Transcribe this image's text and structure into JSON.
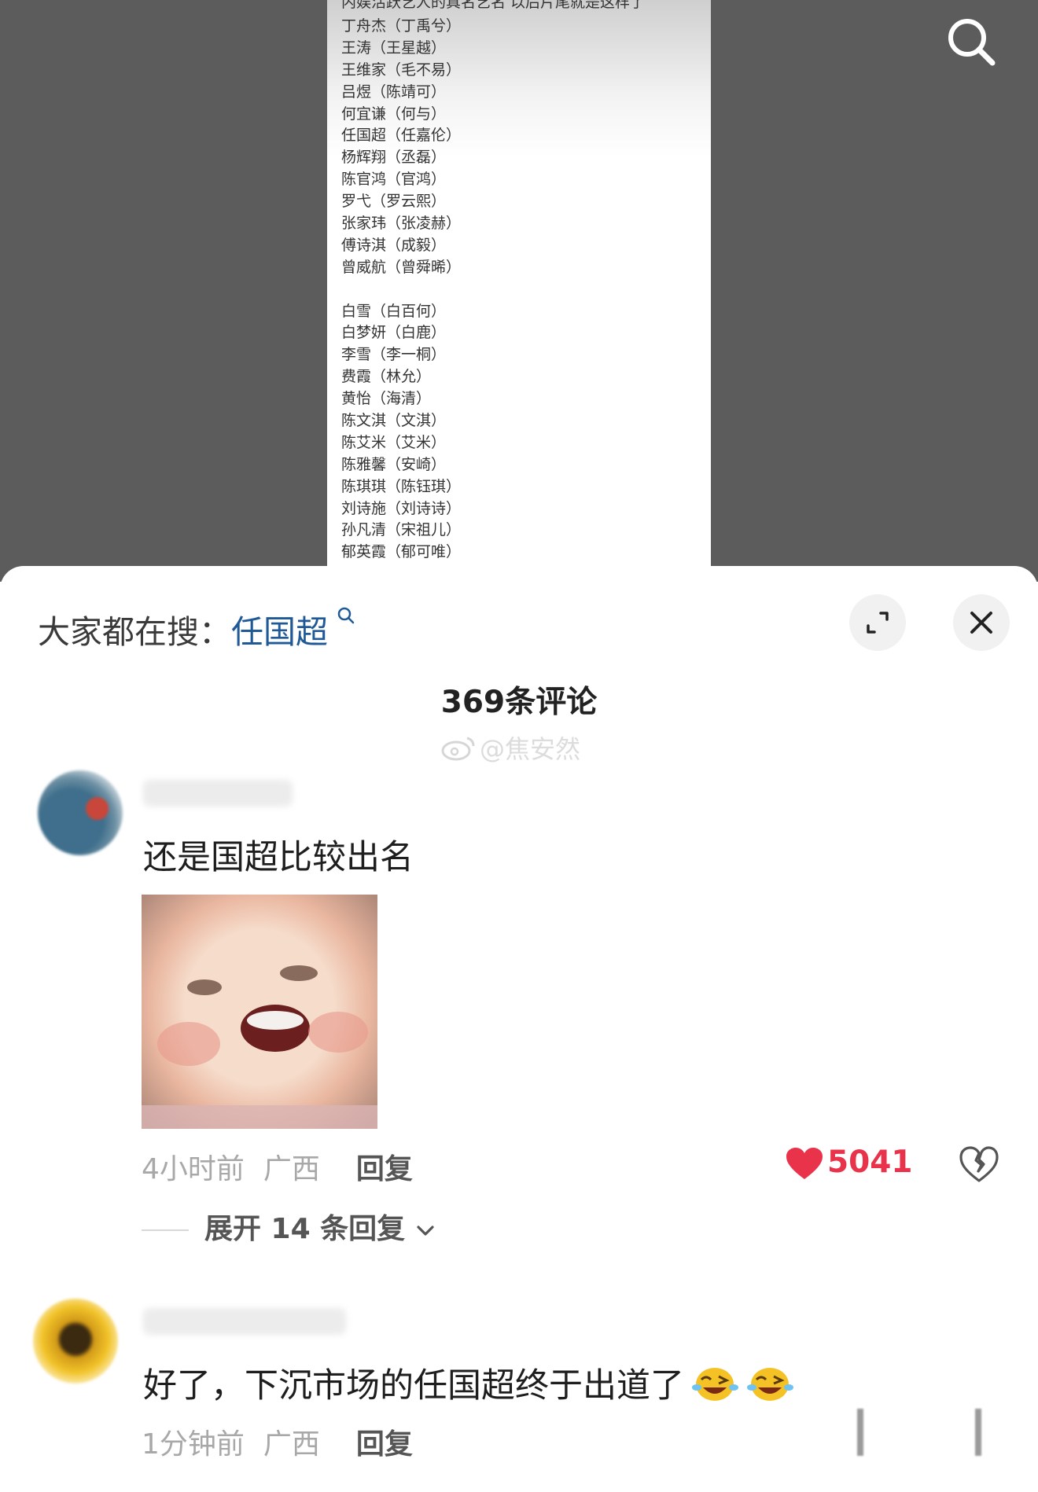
{
  "video": {
    "note_title": "内娱活跃艺人的真名艺名 以后片尾就是这样了",
    "names_group1": [
      "丁舟杰（丁禹兮）",
      "王涛（王星越）",
      "王维家（毛不易）",
      "吕煜（陈靖可）",
      "何宜谦（何与）",
      "任国超（任嘉伦）",
      "杨辉翔（丞磊）",
      "陈官鸿（官鸿）",
      "罗弋（罗云熙）",
      "张家玮（张凌赫）",
      "傅诗淇（成毅）",
      "曾威航（曾舜晞）"
    ],
    "names_group2": [
      "白雪（白百何）",
      "白梦妍（白鹿）",
      "李雪（李一桐）",
      "费霞（林允）",
      "黄怡（海清）",
      "陈文淇（文淇）",
      "陈艾米（艾米）",
      "陈雅馨（安崎）",
      "陈琪琪（陈钰琪）",
      "刘诗施（刘诗诗）",
      "孙凡清（宋祖儿）",
      "郁英霞（郁可唯）"
    ],
    "search_icon": "search-icon"
  },
  "sheet": {
    "hot_search_label": "大家都在搜：",
    "hot_search_keyword": "任国超",
    "expand_icon": "expand-icon",
    "close_icon": "close-icon",
    "comment_count": "369条评论",
    "watermark": "@焦安然"
  },
  "comments": [
    {
      "text": "还是国超比较出名",
      "time": "4小时前",
      "location": "广西",
      "reply_label": "回复",
      "likes": "5041",
      "expand_label": "展开 14 条回复"
    },
    {
      "text": "好了，下沉市场的任国超终于出道了",
      "time": "1分钟前",
      "location": "广西",
      "reply_label": "回复"
    }
  ],
  "colors": {
    "accent_like": "#e8334a",
    "keyword_link": "#1f5a96"
  }
}
